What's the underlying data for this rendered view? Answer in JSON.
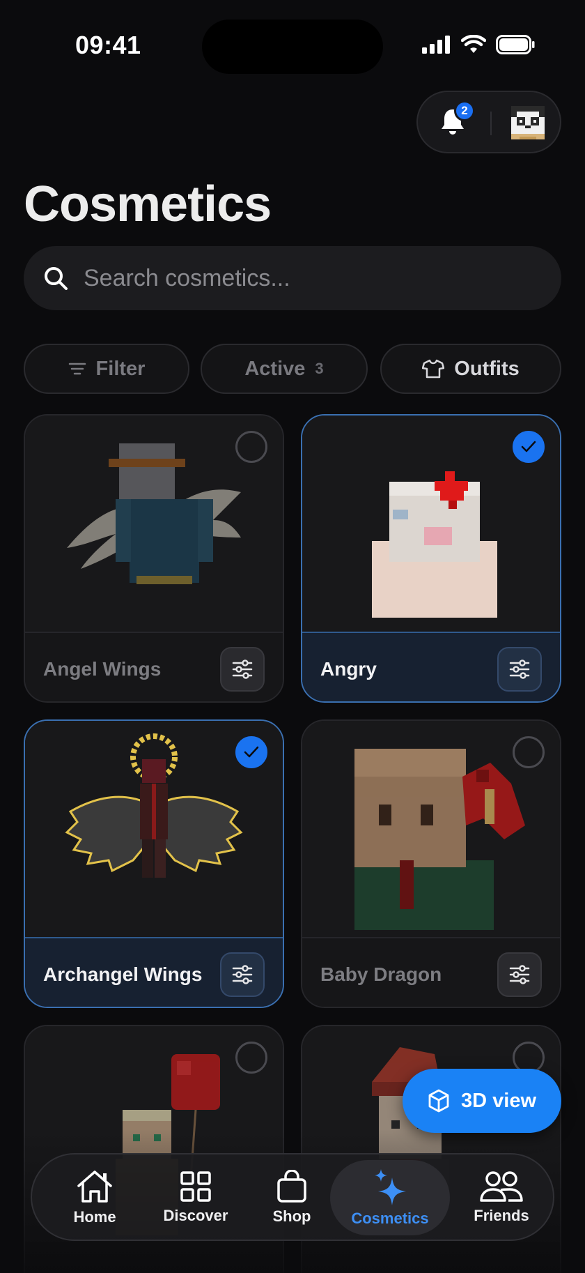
{
  "status_bar": {
    "time": "09:41"
  },
  "header": {
    "notification_count": "2",
    "title": "Cosmetics"
  },
  "search": {
    "placeholder": "Search cosmetics..."
  },
  "chips": {
    "filter": "Filter",
    "active": "Active",
    "active_count": "3",
    "outfits": "Outfits"
  },
  "cosmetics": [
    {
      "name": "Angel Wings",
      "selected": false
    },
    {
      "name": "Angry",
      "selected": true
    },
    {
      "name": "Archangel Wings",
      "selected": true
    },
    {
      "name": "Baby Dragon",
      "selected": false
    },
    {
      "name": "",
      "selected": false
    },
    {
      "name": "",
      "selected": false
    }
  ],
  "fab": {
    "label": "3D view"
  },
  "tabbar": {
    "items": [
      {
        "label": "Home",
        "icon": "home-icon"
      },
      {
        "label": "Discover",
        "icon": "grid-icon"
      },
      {
        "label": "Shop",
        "icon": "bag-icon"
      },
      {
        "label": "Cosmetics",
        "icon": "sparkles-icon",
        "active": true
      },
      {
        "label": "Friends",
        "icon": "people-icon"
      }
    ]
  },
  "colors": {
    "accent": "#1a82f5",
    "background": "#0b0b0d",
    "card": "#141416",
    "active_tab": "#3d8ff5"
  }
}
